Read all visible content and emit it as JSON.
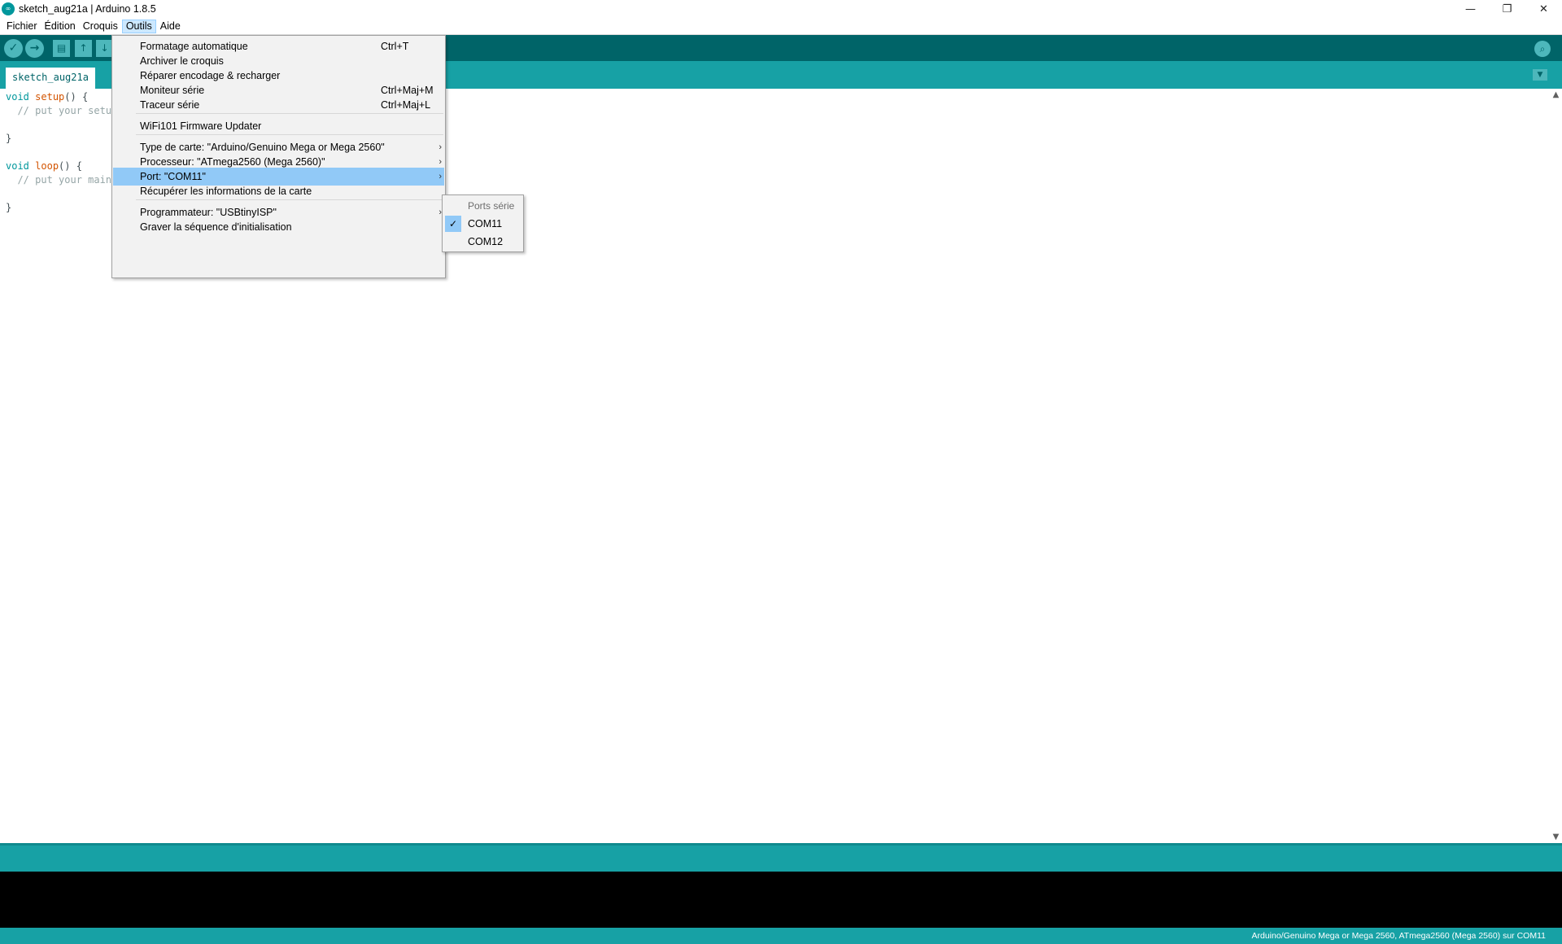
{
  "window": {
    "title": "sketch_aug21a | Arduino 1.8.5",
    "app_icon_text": "∞",
    "minimize": "—",
    "restore": "❐",
    "close": "✕"
  },
  "menubar": {
    "items": [
      "Fichier",
      "Édition",
      "Croquis",
      "Outils",
      "Aide"
    ],
    "active": "Outils"
  },
  "toolbar": {
    "verify": "✓",
    "upload": "→",
    "new": "▤",
    "open": "↑",
    "save": "↓",
    "serial_monitor": "⌕"
  },
  "tabs": {
    "active_tab": "sketch_aug21a",
    "tab_menu": "▼"
  },
  "editor": {
    "lines": [
      {
        "kw": "void",
        "fn": "setup",
        "rest": "() {"
      },
      {
        "comment": "  // put your setup"
      },
      {
        "plain": ""
      },
      {
        "plain": "}"
      },
      {
        "plain": ""
      },
      {
        "kw": "void",
        "fn": "loop",
        "rest": "() {"
      },
      {
        "comment": "  // put your main"
      },
      {
        "plain": ""
      },
      {
        "plain": "}"
      }
    ],
    "scroll_up": "▲",
    "scroll_down": "▼"
  },
  "outils_menu": {
    "items": [
      {
        "label": "Formatage automatique",
        "shortcut": "Ctrl+T"
      },
      {
        "label": "Archiver le croquis",
        "shortcut": ""
      },
      {
        "label": "Réparer encodage & recharger",
        "shortcut": ""
      },
      {
        "label": "Moniteur série",
        "shortcut": "Ctrl+Maj+M"
      },
      {
        "label": "Traceur série",
        "shortcut": "Ctrl+Maj+L"
      },
      {
        "label": "WiFi101 Firmware Updater",
        "shortcut": ""
      },
      {
        "label": "Type de carte: \"Arduino/Genuino Mega or Mega 2560\"",
        "submenu": "›"
      },
      {
        "label": "Processeur: \"ATmega2560 (Mega 2560)\"",
        "submenu": "›"
      },
      {
        "label": "Port: \"COM11\"",
        "submenu": "›",
        "highlighted": true
      },
      {
        "label": "Récupérer les informations de la carte",
        "shortcut": ""
      },
      {
        "label": "Programmateur: \"USBtinyISP\"",
        "submenu": "›"
      },
      {
        "label": "Graver la séquence d'initialisation",
        "shortcut": ""
      }
    ]
  },
  "port_submenu": {
    "header": "Ports série",
    "items": [
      {
        "label": "COM11",
        "checked": true,
        "check": "✓"
      },
      {
        "label": "COM12",
        "checked": false
      }
    ]
  },
  "footer": {
    "board_info": "Arduino/Genuino Mega or Mega 2560, ATmega2560 (Mega 2560) sur COM11"
  },
  "colors": {
    "toolbar": "#006468",
    "tabstrip": "#17a1a5",
    "highlight": "#91c9f7",
    "keyword": "#00979c",
    "function": "#d35400",
    "comment": "#95a5a6"
  }
}
